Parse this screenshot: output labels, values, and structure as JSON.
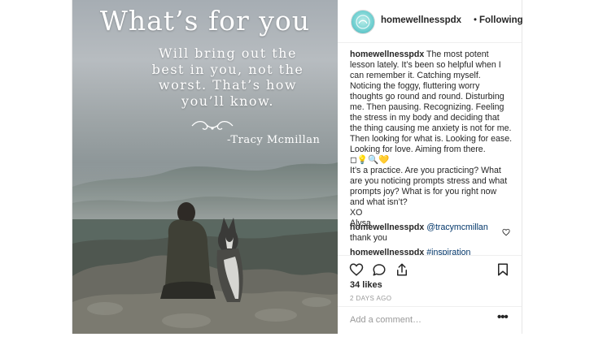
{
  "photo": {
    "quote_title": "What’s for you",
    "quote_body": "Will bring out the\nbest in you, not the\nworst. That’s how\nyou’ll know.",
    "quote_author": "-Tracy Mcmillan"
  },
  "header": {
    "username": "homewellnesspdx",
    "separator": "•",
    "follow_label": "Following",
    "avatar_icon": "avatar-logo"
  },
  "caption": {
    "username": "homewellnesspdx",
    "paragraph1": "The most potent lesson lately. It’s been so helpful when I can remember it. Catching myself. Noticing the foggy, fluttering worry thoughts go round and round. Disturbing me. Then pausing. Recognizing. Feeling the stress in my body and deciding that the thing causing me anxiety is not for me. Then looking for what is. Looking for ease. Looking for love. Aiming from there.",
    "emoji": "◻💡🔍💛",
    "paragraph2": "It’s a practice. Are you practicing? What are you noticing prompts stress and what prompts joy? What is for you right now and what isn’t?",
    "signoff1": "XO",
    "signoff2": "Alysa"
  },
  "comments": [
    {
      "username": "homewellnesspdx",
      "mention": "@tracymcmillan",
      "text": "thank you"
    },
    {
      "username": "homewellnesspdx",
      "hashtag": "#inspiration"
    }
  ],
  "actions": {
    "icons": [
      "heart-icon",
      "comment-icon",
      "share-icon",
      "bookmark-icon"
    ],
    "likes": "34 likes",
    "time_ago": "2 DAYS AGO",
    "add_comment_placeholder": "Add a comment…",
    "more_label": "•••"
  },
  "colors": {
    "text": "#262626",
    "muted": "#999999",
    "border": "#efefef",
    "link": "#003569"
  }
}
